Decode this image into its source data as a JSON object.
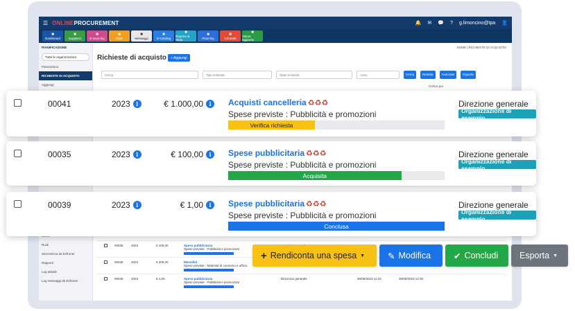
{
  "app": {
    "brand_a": "ONLINE",
    "brand_b": "PROCUREMENT",
    "user": "g.limoncino@tpa",
    "modules": [
      {
        "label": "Dashboard",
        "color": "#1a56a8"
      },
      {
        "label": "Suppliers",
        "color": "#3a9b45"
      },
      {
        "label": "E-sourcing",
        "color": "#d04a8c"
      },
      {
        "label": "Gare",
        "color": "#f0a020"
      },
      {
        "label": "Messaggi",
        "color": "#e8e8e8"
      },
      {
        "label": "E-Catalog",
        "color": "#2a7de1"
      },
      {
        "label": "Reporte & Stats",
        "color": "#27a2c8"
      },
      {
        "label": "Planning",
        "color": "#2d6fd6"
      },
      {
        "label": "Contratti",
        "color": "#e04b3a"
      },
      {
        "label": "Valore aggiunto",
        "color": "#2c9b47"
      }
    ]
  },
  "sidebar": {
    "title": "PIANIFICAZIONE",
    "org_select": "Tutte le organizzazioni",
    "overview": "Panoramica",
    "section": "RICHIESTE DI ACQUISTO",
    "add": "Aggiungi",
    "items": [
      "Utenti",
      "Ruoli",
      "Sincronizza da Ezfroner",
      "Rapporti",
      "Log attività",
      "Log messaggi da Ezfroner"
    ]
  },
  "main": {
    "breadcrumb": "HOME  |  RICHIESTE DI ACQUISTO",
    "title": "Richieste di acquisto",
    "add_button": "+ Aggiungi",
    "filters": [
      "Cerca",
      "Tipo richiesta",
      "Stato richiesta",
      "Anno"
    ],
    "filter_buttons": [
      "Cerca",
      "Resetta",
      "Avanzate",
      "Esporta"
    ],
    "group_label": "Ordina per"
  },
  "cards": [
    {
      "code": "00041",
      "year": "2023",
      "amount": "€ 1.000,00",
      "title": "Acquisti cancelleria",
      "spese": "Spese previste : Pubblicità e promozioni",
      "status": "Verifica richiesta",
      "progress": 40,
      "bar_color": "#f8c215",
      "text_color": "#222",
      "dept": "Direzione generale",
      "org": "Organizzazione di esempio"
    },
    {
      "code": "00035",
      "year": "2023",
      "amount": "€ 100,00",
      "title": "Spese pubblicitaria",
      "spese": "Spese previste : Pubblicità e promozioni",
      "status": "Acquisita",
      "progress": 80,
      "bar_color": "#22a847",
      "text_color": "#ffffff",
      "dept": "Direzione generale",
      "org": "Organizzazione di esempio"
    },
    {
      "code": "00039",
      "year": "2023",
      "amount": "€ 1,00",
      "title": "Spese pubblicitaria",
      "spese": "Spese previste : Pubblicità e promozioni",
      "status": "Conclusa",
      "progress": 100,
      "bar_color": "#1a73e8",
      "text_color": "#ffffff",
      "dept": "Direzione generale",
      "org": "Organizzazione di esempio"
    }
  ],
  "background_rows": [
    {
      "code": "00035",
      "year": "2023",
      "amount": "€ 100,00",
      "title": "Spese pubblicitaria",
      "spese": "Spese previste : Pubblicità e promozioni",
      "dept": "Direzione generale",
      "date_a": "",
      "date_b": ""
    },
    {
      "code": "00036",
      "year": "2023",
      "amount": "€ 200,00",
      "title": "Mensilità",
      "spese": "Spese previste : Materiali di consumo e ufficio",
      "dept": "",
      "date_a": "",
      "date_b": ""
    },
    {
      "code": "00039",
      "year": "2023",
      "amount": "€ 1,00",
      "title": "Spese pubblicitaria",
      "spese": "Spese previste : Pubblicità e promozioni",
      "dept": "Direzione generale",
      "date_a": "30/05/2023 11:24",
      "date_b": "30/05/2023 12:30"
    }
  ],
  "actions": {
    "rendiconta": "Rendiconta una spesa",
    "modifica": "Modifica",
    "concludi": "Concludi",
    "esporta": "Esporta"
  }
}
